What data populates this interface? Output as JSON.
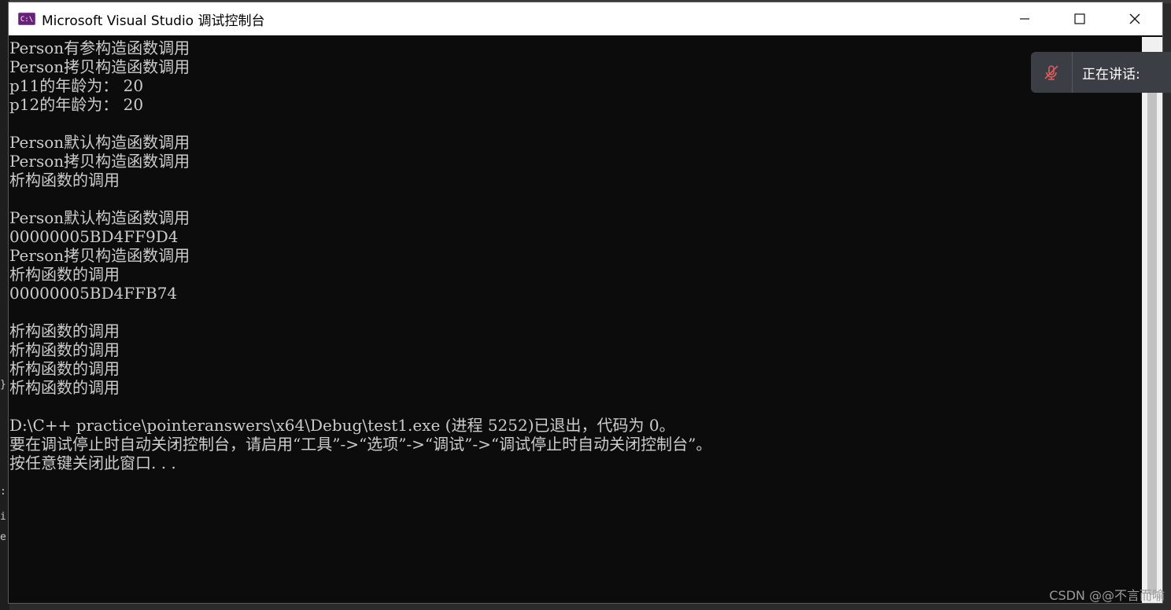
{
  "window": {
    "icon_label": "C:\\",
    "title": "Microsoft Visual Studio 调试控制台"
  },
  "console": {
    "lines": [
      "Person有参构造函数调用",
      "Person拷贝构造函数调用",
      "p11的年龄为： 20",
      "p12的年龄为： 20",
      "",
      "Person默认构造函数调用",
      "Person拷贝构造函数调用",
      "析构函数的调用",
      "",
      "Person默认构造函数调用",
      "00000005BD4FF9D4",
      "Person拷贝构造函数调用",
      "析构函数的调用",
      "00000005BD4FFB74",
      "",
      "析构函数的调用",
      "析构函数的调用",
      "析构函数的调用",
      "析构函数的调用",
      "",
      "D:\\C++ practice\\pointeranswers\\x64\\Debug\\test1.exe (进程 5252)已退出，代码为 0。",
      "要在调试停止时自动关闭控制台，请启用“工具”->“选项”->“调试”->“调试停止时自动关闭控制台”。",
      "按任意键关闭此窗口. . ."
    ]
  },
  "notification": {
    "text": "正在讲话:"
  },
  "watermark": {
    "text": "CSDN @@不言而喻"
  },
  "background": {
    "glyphs": [
      "}",
      ":",
      "i",
      "e"
    ]
  },
  "colors": {
    "console_bg": "#0c0c0c",
    "console_fg": "#cccccc",
    "titlebar_bg": "#ffffff",
    "toast_bg": "#3b3f45",
    "mic_muted": "#e05a5a",
    "vs_purple": "#68217a"
  },
  "icons": {
    "app": "console-app-icon",
    "minimize": "minimize-icon",
    "maximize": "maximize-icon",
    "close": "close-icon",
    "mic": "microphone-muted-icon"
  }
}
